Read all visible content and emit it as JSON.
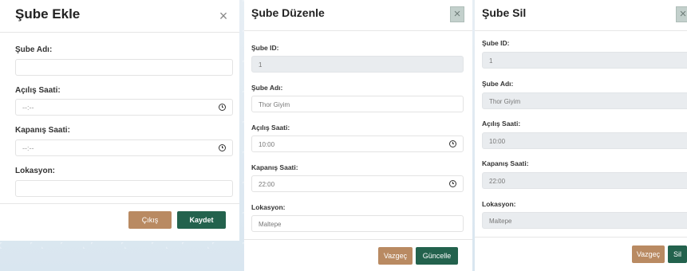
{
  "add_modal": {
    "title": "Şube Ekle",
    "close_glyph": "×",
    "fields": {
      "name": {
        "label": "Şube Adı:",
        "value": ""
      },
      "open": {
        "label": "Açılış Saati:",
        "placeholder": "--:--"
      },
      "close": {
        "label": "Kapanış Saati:",
        "placeholder": "--:--"
      },
      "location": {
        "label": "Lokasyon:",
        "value": ""
      }
    },
    "exit_label": "Çıkış",
    "save_label": "Kaydet"
  },
  "edit_modal": {
    "title": "Şube Düzenle",
    "close_glyph": "×",
    "fields": {
      "id": {
        "label": "Şube ID:",
        "value": "1"
      },
      "name": {
        "label": "Şube Adı:",
        "value": "Thor Giyim"
      },
      "open": {
        "label": "Açılış Saati:",
        "value": "10:00"
      },
      "close": {
        "label": "Kapanış Saati:",
        "value": "22:00"
      },
      "location": {
        "label": "Lokasyon:",
        "value": "Maltepe"
      }
    },
    "cancel_label": "Vazgeç",
    "update_label": "Güncelle"
  },
  "delete_modal": {
    "title": "Şube Sil",
    "close_glyph": "×",
    "fields": {
      "id": {
        "label": "Şube ID:",
        "value": "1"
      },
      "name": {
        "label": "Şube Adı:",
        "value": "Thor Giyim"
      },
      "open": {
        "label": "Açılış Saati:",
        "value": "10:00"
      },
      "close": {
        "label": "Kapanış Saati:",
        "value": "22:00"
      },
      "location": {
        "label": "Lokasyon:",
        "value": "Maltepe"
      }
    },
    "cancel_label": "Vazgeç",
    "delete_label": "Sil"
  },
  "colors": {
    "primary_button": "#23624d",
    "secondary_button": "#b98a62"
  }
}
